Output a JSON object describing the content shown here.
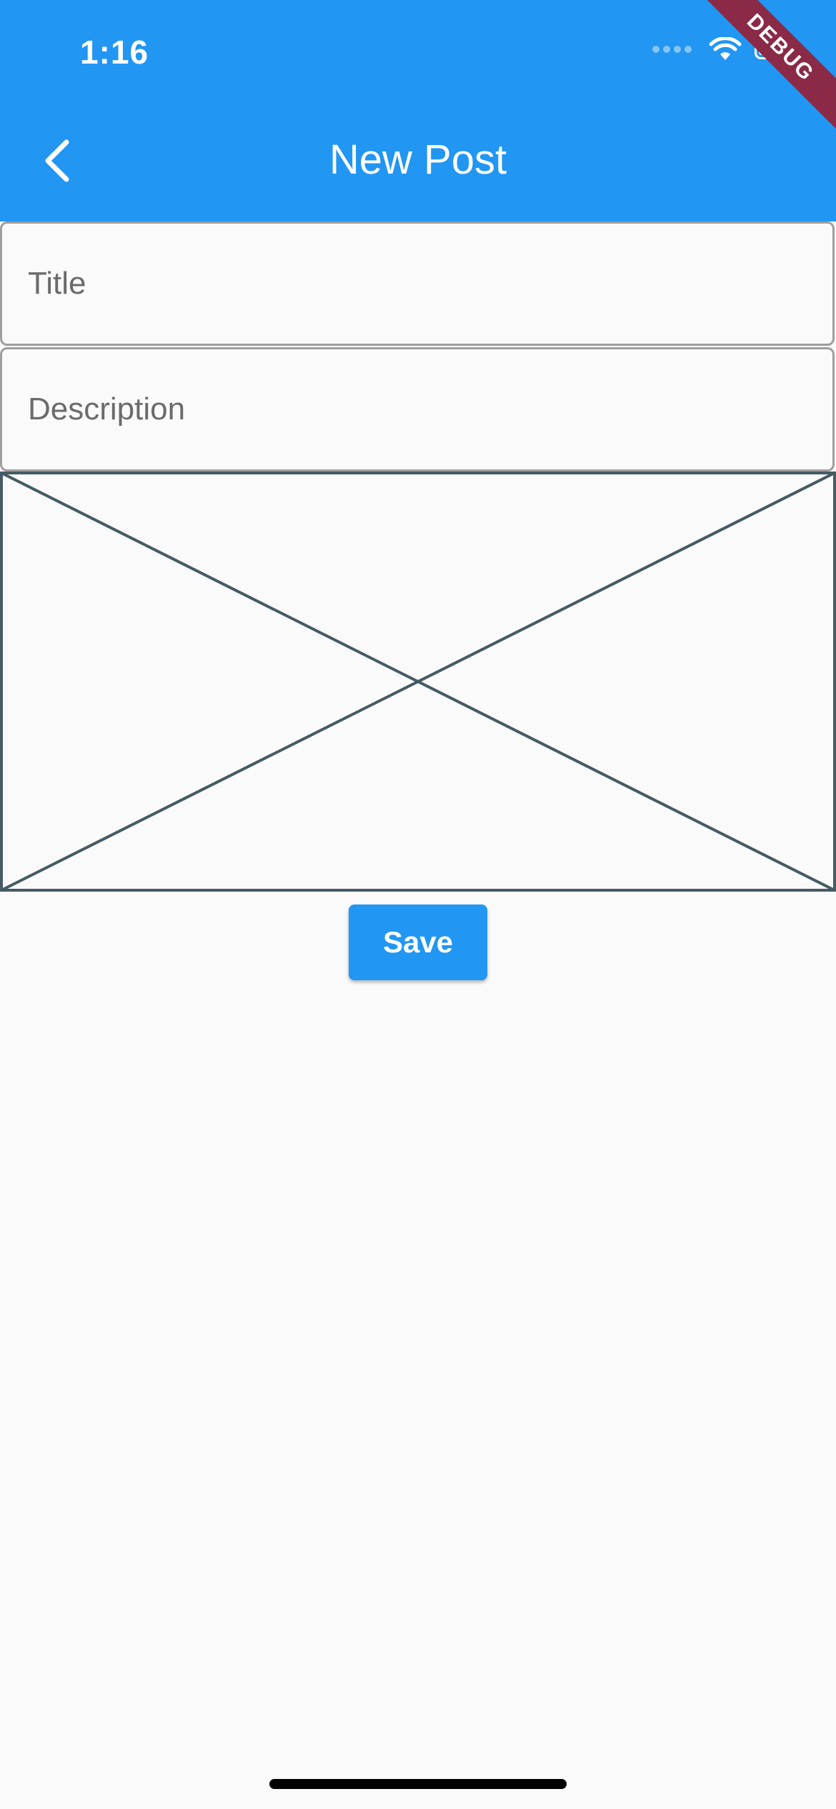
{
  "status_bar": {
    "time": "1:16",
    "icons": [
      "cellular-signal-icon",
      "wifi-icon",
      "battery-icon"
    ]
  },
  "app_bar": {
    "title": "New Post",
    "back_icon": "chevron-left-icon",
    "background_color": "#2196f3"
  },
  "debug_banner": {
    "label": "DEBUG",
    "color": "#8a2a46"
  },
  "form": {
    "title_placeholder": "Title",
    "title_value": "",
    "description_placeholder": "Description",
    "description_value": "",
    "image_placeholder_icon": "image-placeholder-icon",
    "save_label": "Save"
  },
  "colors": {
    "accent": "#2196f3",
    "background": "#fafafa",
    "placeholder_stroke": "#455a64"
  }
}
